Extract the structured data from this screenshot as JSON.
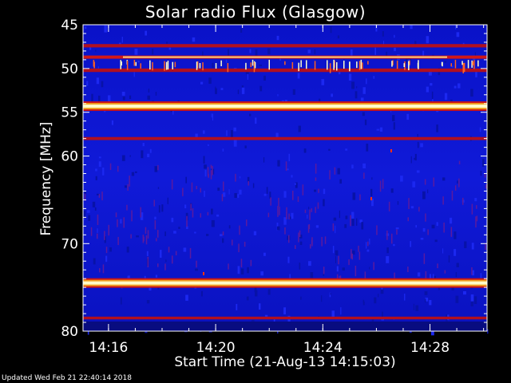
{
  "window": {
    "title": "Solar radio Flux (Glasgow)",
    "footer": "Updated Wed Feb 21 22:40:14 2018"
  },
  "colors": {
    "background": "#000000",
    "low": "#0a10d8",
    "mid": "#c81418",
    "high": "#ffffc8",
    "text": "#ffffff"
  },
  "chart_data": {
    "type": "heatmap",
    "title": "Solar radio Flux (Glasgow)",
    "xlabel": "Start Time (21-Aug-13 14:15:03)",
    "ylabel": "Frequency [MHz]",
    "x_unit": "minutes after 14:15:03",
    "xlim": [
      "14:15:03",
      "14:30:08"
    ],
    "xticks": [
      "14:16",
      "14:20",
      "14:24",
      "14:28"
    ],
    "xtick_values": [
      0.95,
      4.95,
      8.95,
      12.95
    ],
    "xlim_values": [
      0,
      15.08
    ],
    "ylim": [
      45,
      80
    ],
    "y_reversed": true,
    "yticks": [
      45,
      50,
      55,
      60,
      70,
      80
    ],
    "ytick_labels": [
      "45",
      "50",
      "55",
      "60",
      "70",
      "80"
    ],
    "bands": [
      {
        "freq": 47.4,
        "intensity": 0.55
      },
      {
        "freq": 48.7,
        "intensity": 0.85
      },
      {
        "freq": 50.2,
        "intensity": 0.6
      },
      {
        "freq": 54.3,
        "intensity": 1.0
      },
      {
        "freq": 58.0,
        "intensity": 0.45
      },
      {
        "freq": 74.5,
        "intensity": 1.0
      },
      {
        "freq": 78.5,
        "intensity": 0.35
      }
    ]
  }
}
